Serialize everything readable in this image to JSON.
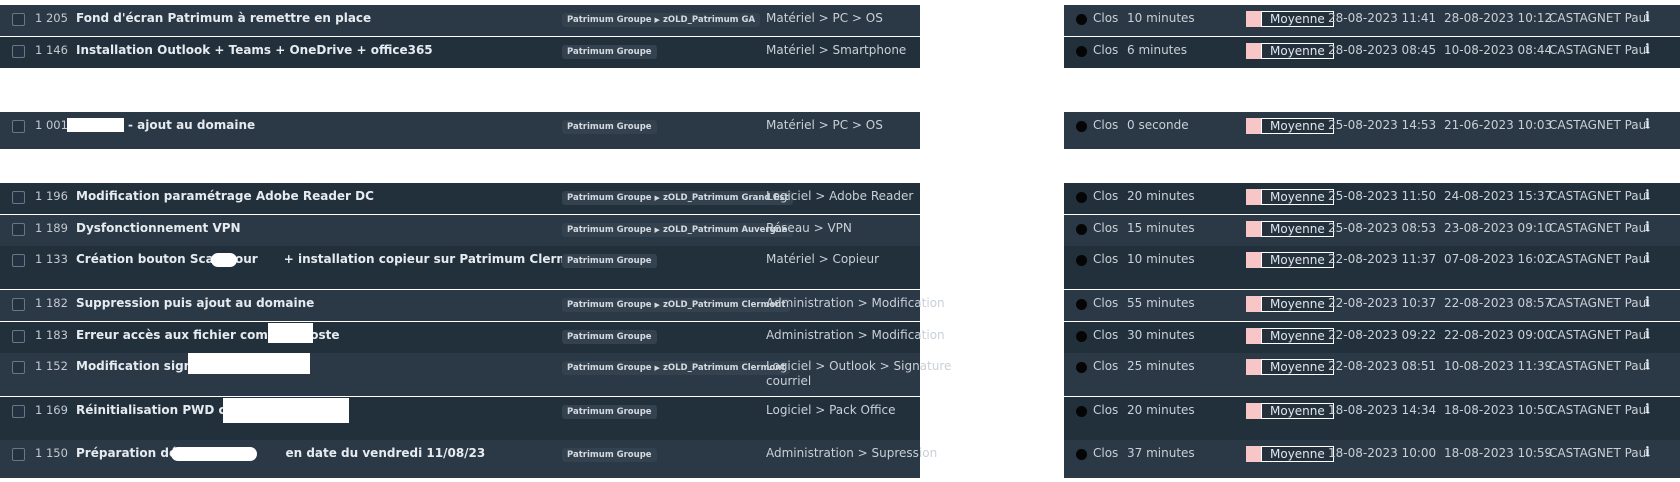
{
  "status_label": "Clos",
  "priority_label": "Moyenne",
  "technician": "CASTAGNET Paul",
  "info_icon": "info-icon",
  "colors": {
    "row_dark": "#22303c",
    "row_light": "#2b3846",
    "priority_swatch": "#f8c6c6"
  },
  "rows": [
    {
      "id": "1 205",
      "title": "Fond d'écran Patrimum à remettre en place",
      "entity": "Patrimum Groupe",
      "entity_child": "zOLD_Patrimum GA",
      "category": "Matériel > PC > OS",
      "category2": "",
      "duration": "10 minutes",
      "date_closed": "28-08-2023 11:41",
      "date_open": "28-08-2023 10:12"
    },
    {
      "id": "1 146",
      "title": "Installation Outlook + Teams + OneDrive + office365",
      "entity": "Patrimum Groupe",
      "entity_child": "",
      "category": "Matériel > Smartphone",
      "category2": "",
      "duration": "6 minutes",
      "date_closed": "28-08-2023 08:45",
      "date_open": "10-08-2023 08:44"
    },
    {
      "id": "1 001",
      "title": "- ajout au domaine",
      "entity": "Patrimum Groupe",
      "entity_child": "",
      "category": "Matériel > PC > OS",
      "category2": "",
      "duration": "0 seconde",
      "date_closed": "25-08-2023 14:53",
      "date_open": "21-06-2023 10:03"
    },
    {
      "id": "1 196",
      "title": "Modification paramétrage Adobe Reader DC",
      "entity": "Patrimum Groupe",
      "entity_child": "zOLD_Patrimum Grand Est",
      "category": "Logiciel > Adobe Reader",
      "category2": "",
      "duration": "20 minutes",
      "date_closed": "25-08-2023 11:50",
      "date_open": "24-08-2023 15:37"
    },
    {
      "id": "1 189",
      "title": "Dysfonctionnement VPN",
      "entity": "Patrimum Groupe",
      "entity_child": "zOLD_Patrimum Auvergne",
      "category": "Réseau > VPN",
      "category2": "",
      "duration": "15 minutes",
      "date_closed": "25-08-2023 08:53",
      "date_open": "23-08-2023 09:10"
    },
    {
      "id": "1 133",
      "title": "Création bouton Scan pour",
      "title2": "+ installation copieur sur Patrimum Clermont",
      "entity": "Patrimum Groupe",
      "entity_child": "",
      "category": "Matériel > Copieur",
      "category2": "",
      "duration": "10 minutes",
      "date_closed": "22-08-2023 11:37",
      "date_open": "07-08-2023 16:02"
    },
    {
      "id": "1 182",
      "title": "Suppression puis ajout au domaine",
      "entity": "Patrimum Groupe",
      "entity_child": "zOLD_Patrimum Clermont",
      "category": "Administration > Modification",
      "category2": "",
      "duration": "55 minutes",
      "date_closed": "22-08-2023 10:37",
      "date_open": "22-08-2023 08:57"
    },
    {
      "id": "1 183",
      "title": "Erreur accès aux fichier commun poste",
      "entity": "Patrimum Groupe",
      "entity_child": "",
      "category": "Administration > Modification",
      "category2": "",
      "duration": "30 minutes",
      "date_closed": "22-08-2023 09:22",
      "date_open": "22-08-2023 09:00"
    },
    {
      "id": "1 152",
      "title": "Modification signature",
      "entity": "Patrimum Groupe",
      "entity_child": "zOLD_Patrimum Clermont",
      "category": "Logiciel > Outlook > Signature",
      "category2": "courriel",
      "duration": "25 minutes",
      "date_closed": "22-08-2023 08:51",
      "date_open": "10-08-2023 11:39"
    },
    {
      "id": "1 169",
      "title": "Réinitialisation PWD comptes",
      "entity": "Patrimum Groupe",
      "entity_child": "",
      "category": "Logiciel > Pack Office",
      "category2": "",
      "duration": "20 minutes",
      "date_closed": "18-08-2023 14:34",
      "date_open": "18-08-2023 10:50"
    },
    {
      "id": "1 150",
      "title": "Préparation départ",
      "title2": "en date du vendredi 11/08/23",
      "entity": "Patrimum Groupe",
      "entity_child": "",
      "category": "Administration > Supression",
      "category2": "",
      "duration": "37 minutes",
      "date_closed": "18-08-2023 10:00",
      "date_open": "18-08-2023 10:59"
    }
  ]
}
